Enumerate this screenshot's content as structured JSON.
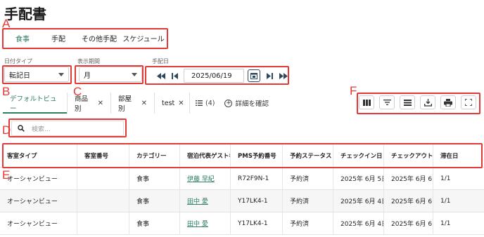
{
  "page": {
    "title": "手配書"
  },
  "category_tabs": [
    {
      "label": "食事",
      "active": true
    },
    {
      "label": "手配",
      "active": false
    },
    {
      "label": "その他手配",
      "active": false
    },
    {
      "label": "スケジュール",
      "active": false
    }
  ],
  "filters": {
    "date_type": {
      "label": "日付タイプ",
      "value": "転記日"
    },
    "period": {
      "label": "表示期間",
      "value": "月"
    },
    "arrangement_date": {
      "label": "手配日",
      "value": "2025/06/19"
    }
  },
  "views": {
    "tabs": [
      {
        "label": "デフォルトビュー",
        "active": true,
        "closable": false
      },
      {
        "label": "商品別",
        "active": false,
        "closable": true
      },
      {
        "label": "部屋別",
        "active": false,
        "closable": true
      },
      {
        "label": "test",
        "active": false,
        "closable": true
      }
    ],
    "list_count": "(4)",
    "detail_label": "詳細を確認"
  },
  "search": {
    "placeholder": "検索..."
  },
  "markers": {
    "a": "A",
    "b": "B",
    "c": "C",
    "d": "D",
    "e": "E",
    "f": "F"
  },
  "table": {
    "columns": [
      "客室タイプ",
      "客室番号",
      "カテゴリー",
      "宿泊代表ゲスト名",
      "PMS予約番号",
      "予約ステータス",
      "チェックイン日",
      "チェックアウト日",
      "滞在日"
    ],
    "rows": [
      [
        "オーシャンビュー",
        "",
        "食事",
        "伊藤 早紀",
        "R72F9N-1",
        "予約済",
        "2025年 6月 5日",
        "2025年 6月 6日",
        "1/1"
      ],
      [
        "オーシャンビュー",
        "",
        "食事",
        "田中 愛",
        "Y17LK4-1",
        "予約済",
        "2025年 6月 4日",
        "2025年 6月 6日",
        "1/1"
      ],
      [
        "オーシャンビュー",
        "",
        "食事",
        "田中 愛",
        "Y17LK4-1",
        "予約済",
        "2025年 6月 4日",
        "2025年 6月 6日",
        "1/1"
      ]
    ]
  },
  "colors": {
    "accent": "#2e7d5b",
    "annotation": "#e53935",
    "nav": "#2b4a5e"
  }
}
